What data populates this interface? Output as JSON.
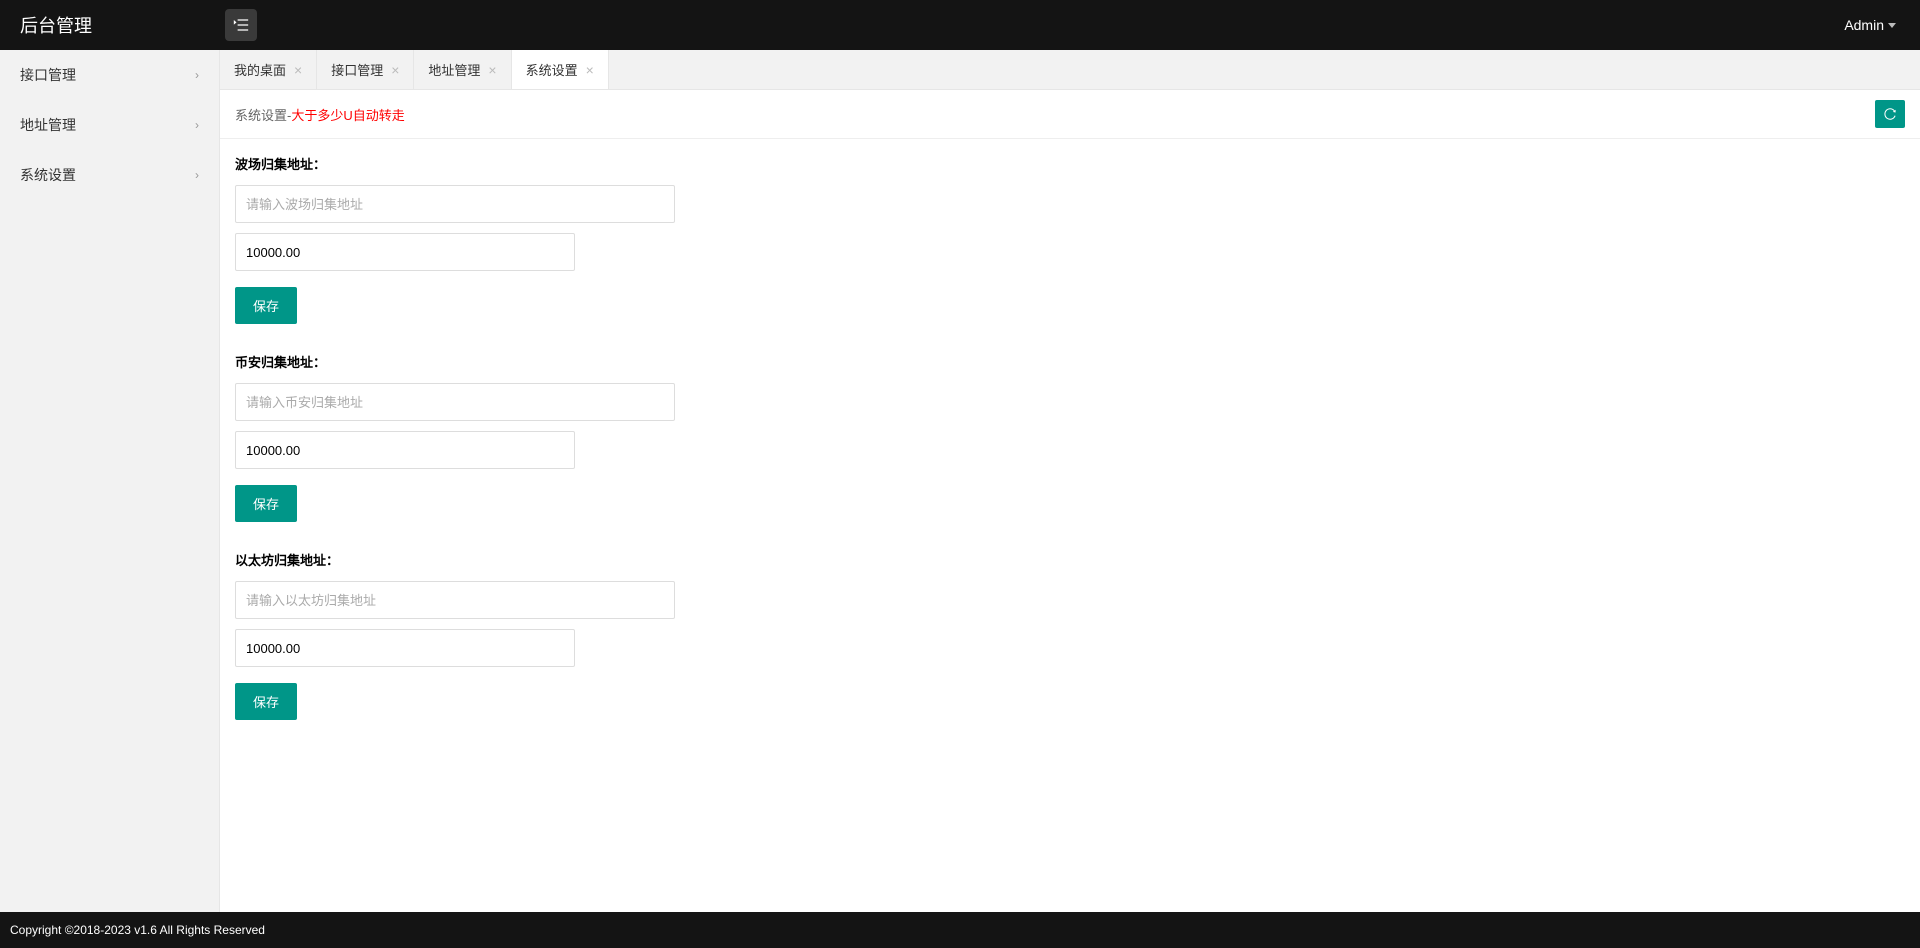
{
  "header": {
    "brand": "后台管理",
    "user": "Admin"
  },
  "sidebar": {
    "items": [
      {
        "label": "接口管理"
      },
      {
        "label": "地址管理"
      },
      {
        "label": "系统设置"
      }
    ]
  },
  "tabs": [
    {
      "label": "我的桌面",
      "closable": true,
      "active": false
    },
    {
      "label": "接口管理",
      "closable": true,
      "active": false
    },
    {
      "label": "地址管理",
      "closable": true,
      "active": false
    },
    {
      "label": "系统设置",
      "closable": true,
      "active": true
    }
  ],
  "contentHeader": {
    "title": "系统设置-",
    "suffix": "大于多少U自动转走"
  },
  "forms": [
    {
      "label": "波场归集地址：",
      "placeholder": "请输入波场归集地址",
      "address_value": "",
      "amount_value": "10000.00",
      "save_label": "保存"
    },
    {
      "label": "币安归集地址：",
      "placeholder": "请输入币安归集地址",
      "address_value": "",
      "amount_value": "10000.00",
      "save_label": "保存"
    },
    {
      "label": "以太坊归集地址：",
      "placeholder": "请输入以太坊归集地址",
      "address_value": "",
      "amount_value": "10000.00",
      "save_label": "保存"
    }
  ],
  "footer": {
    "text": "Copyright ©2018-2023 v1.6 All Rights Reserved"
  }
}
